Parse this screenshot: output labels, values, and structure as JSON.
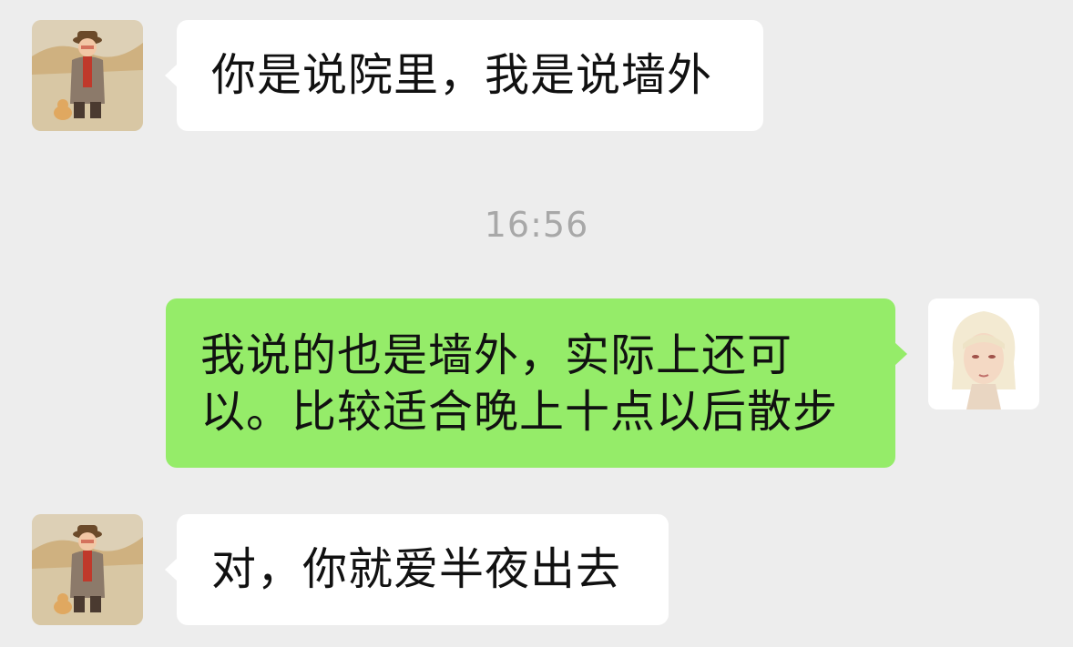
{
  "conversation": {
    "messages": [
      {
        "sender": "contact",
        "text": "你是说院里，我是说墙外"
      },
      {
        "sender": "self",
        "lines": [
          "我说的也是墙外，实际上还可",
          "以。比较适合晚上十点以后散步"
        ]
      },
      {
        "sender": "contact",
        "text": "对，你就爱半夜出去"
      }
    ],
    "timestamp": "16:56"
  },
  "avatars": {
    "contact": "old-man-with-cat-avatar",
    "self": "white-haired-girl-avatar"
  },
  "colors": {
    "background": "#ededed",
    "incoming_bubble": "#ffffff",
    "outgoing_bubble": "#95ec69",
    "timestamp_text": "#a8a8a8"
  }
}
